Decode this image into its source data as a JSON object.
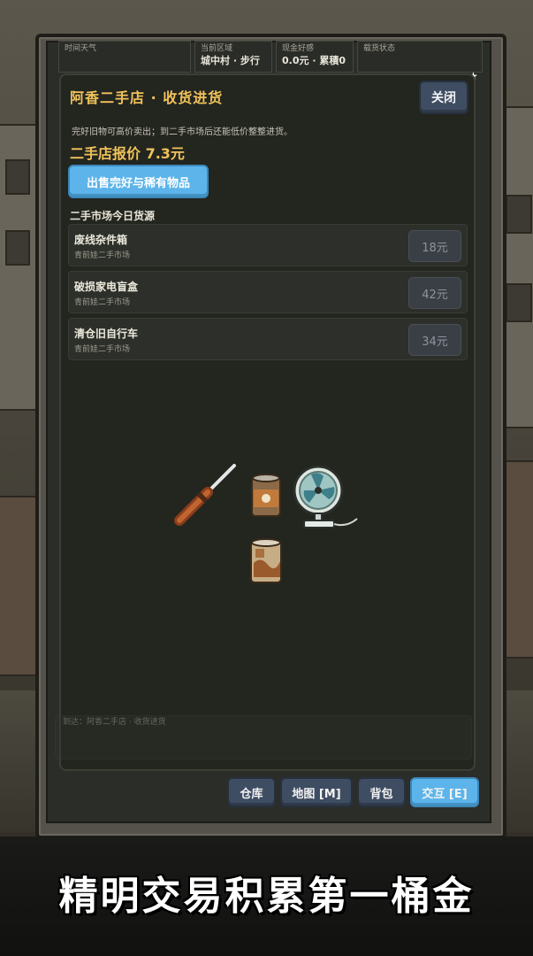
{
  "hud": {
    "weather_caption": "时间天气",
    "area_caption": "当前区域",
    "area_value": "城中村 · 步行",
    "cash_caption": "现金好感",
    "cash_value": "0.0元 · 累積0",
    "cargo_caption": "载货状态"
  },
  "dialog": {
    "title": "阿香二手店 · 收货进货",
    "close_label": "关闭",
    "description": "完好旧物可高价卖出；到二手市场后还能低价整整进货。",
    "price_label": "二手店报价 7.3元",
    "sell_button": "出售完好与稀有物品",
    "section_title": "二手市场今日货源",
    "goods": [
      {
        "name": "废线杂件箱",
        "source": "青前娃二手市场",
        "price": "18元"
      },
      {
        "name": "破损家电盲盒",
        "source": "青前娃二手市场",
        "price": "42元"
      },
      {
        "name": "清仓旧自行车",
        "source": "青前娃二手市场",
        "price": "34元"
      }
    ]
  },
  "log": {
    "line1": "到达：阿香二手店 · 收货进货"
  },
  "bottom_bar": {
    "warehouse": "仓库",
    "map": "地图 [M]",
    "backpack": "背包",
    "interact": "交互 [E]"
  },
  "banner": {
    "text": "精明交易积累第一桶金"
  },
  "colors": {
    "accent_gold": "#f0c35a",
    "button_blue": "#5cb4ea",
    "button_dark": "#3f4d63"
  },
  "icons": [
    "screwdriver-icon",
    "tin-can-icon",
    "electric-fan-icon",
    "rusty-can-icon",
    "star-icon"
  ]
}
